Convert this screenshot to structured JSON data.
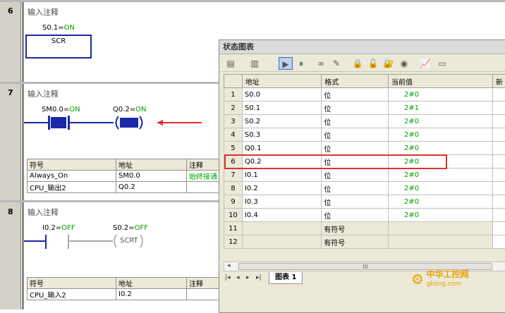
{
  "networks": [
    {
      "number": "6",
      "comment": "输入注释",
      "contact_label": "S0.1",
      "contact_state": "ON",
      "coil": "SCR"
    },
    {
      "number": "7",
      "comment": "输入注释",
      "contact_label": "SM0.0",
      "contact_state": "ON",
      "coil_label": "Q0.2",
      "coil_state": "ON",
      "symbol_table": {
        "headers": [
          "符号",
          "地址",
          "注释"
        ],
        "rows": [
          [
            "Always_On",
            "SM0.0",
            "始终接通"
          ],
          [
            "CPU_输出2",
            "Q0.2",
            ""
          ]
        ]
      }
    },
    {
      "number": "8",
      "comment": "输入注释",
      "contact_label": "I0.2",
      "contact_state": "OFF",
      "coil_label": "S0.2",
      "coil_state": "OFF",
      "coil": "SCRT",
      "symbol_table": {
        "headers": [
          "符号",
          "地址",
          "注释"
        ],
        "rows": [
          [
            "CPU_输入2",
            "I0.2",
            ""
          ]
        ]
      }
    }
  ],
  "status_chart": {
    "title": "状态图表",
    "headers": [
      "",
      "地址",
      "格式",
      "当前值",
      "新"
    ],
    "rows": [
      {
        "n": "1",
        "address": "S0.0",
        "format": "位",
        "value": "2#0"
      },
      {
        "n": "2",
        "address": "S0.1",
        "format": "位",
        "value": "2#1"
      },
      {
        "n": "3",
        "address": "S0.2",
        "format": "位",
        "value": "2#0"
      },
      {
        "n": "4",
        "address": "S0.3",
        "format": "位",
        "value": "2#0"
      },
      {
        "n": "5",
        "address": "Q0.1",
        "format": "位",
        "value": "2#0"
      },
      {
        "n": "6",
        "address": "Q0.2",
        "format": "位",
        "value": "2#0"
      },
      {
        "n": "7",
        "address": "I0.1",
        "format": "位",
        "value": "2#0"
      },
      {
        "n": "8",
        "address": "I0.2",
        "format": "位",
        "value": "2#0"
      },
      {
        "n": "9",
        "address": "I0.3",
        "format": "位",
        "value": "2#0"
      },
      {
        "n": "10",
        "address": "I0.4",
        "format": "位",
        "value": "2#0"
      },
      {
        "n": "11",
        "address": "",
        "format": "有符号",
        "value": ""
      },
      {
        "n": "12",
        "address": "",
        "format": "有符号",
        "value": ""
      }
    ],
    "tab_label": "图表 1",
    "scroll_mark": "III"
  },
  "watermark": {
    "line1": "中华工控网",
    "line2": "gkong.com"
  },
  "colors": {
    "wire_active": "#1a28a8",
    "state_text": "#00a000",
    "highlight": "#e03030"
  }
}
